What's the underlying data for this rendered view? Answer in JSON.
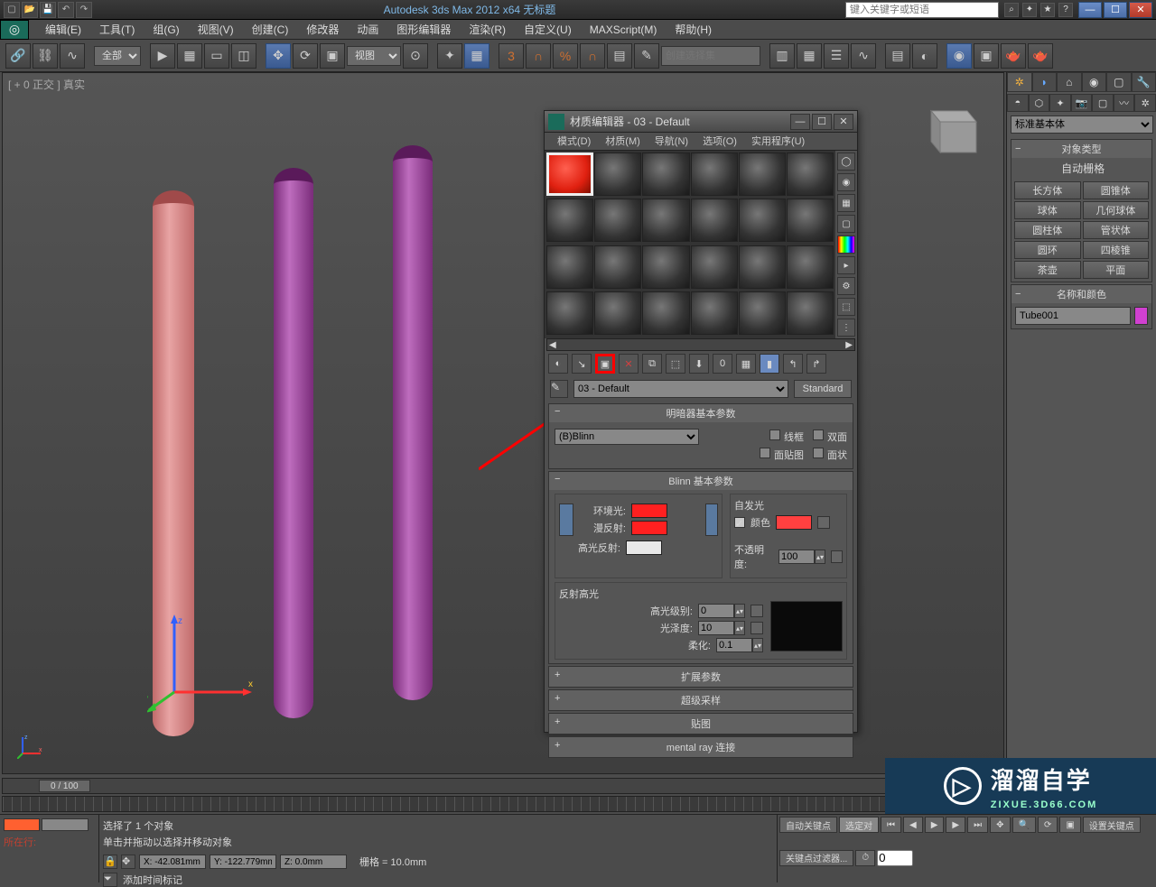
{
  "app": {
    "title": "Autodesk 3ds Max  2012 x64    无标题",
    "search_placeholder": "键入关键字或短语"
  },
  "menu": [
    "编辑(E)",
    "工具(T)",
    "组(G)",
    "视图(V)",
    "创建(C)",
    "修改器",
    "动画",
    "图形编辑器",
    "渲染(R)",
    "自定义(U)",
    "MAXScript(M)",
    "帮助(H)"
  ],
  "toolbar": {
    "filter": "全部",
    "viewset": "视图",
    "selset": "创建选择集"
  },
  "viewport": {
    "label": "[ + 0  正交 ] 真实"
  },
  "cmdpanel": {
    "dropdown": "标准基本体",
    "objtype_title": "对象类型",
    "autogrid": "自动栅格",
    "buttons": [
      [
        "长方体",
        "圆锥体"
      ],
      [
        "球体",
        "几何球体"
      ],
      [
        "圆柱体",
        "管状体"
      ],
      [
        "圆环",
        "四棱锥"
      ],
      [
        "茶壶",
        "平面"
      ]
    ],
    "namecolor_title": "名称和颜色",
    "objname": "Tube001"
  },
  "matedit": {
    "title": "材质编辑器 - 03 - Default",
    "menu": [
      "模式(D)",
      "材质(M)",
      "导航(N)",
      "选项(O)",
      "实用程序(U)"
    ],
    "matname": "03 - Default",
    "standard": "Standard",
    "shader_title": "明暗器基本参数",
    "shader": "(B)Blinn",
    "opt_wire": "线框",
    "opt_2side": "双面",
    "opt_facemap": "面贴图",
    "opt_faceted": "面状",
    "blinn_title": "Blinn 基本参数",
    "ambient": "环境光:",
    "diffuse": "漫反射:",
    "specular": "高光反射:",
    "selfillum_title": "自发光",
    "color_cb": "颜色",
    "opacity": "不透明度:",
    "opacity_val": "100",
    "spechl_title": "反射高光",
    "speclvl": "高光级别:",
    "speclvl_val": "0",
    "gloss": "光泽度:",
    "gloss_val": "10",
    "soften": "柔化:",
    "soften_val": "0.1",
    "rolls": [
      "扩展参数",
      "超级采样",
      "贴图",
      "mental ray 连接"
    ]
  },
  "time": {
    "slider": "0 / 100"
  },
  "status": {
    "script_label": "所在行:",
    "sel": "选择了 1 个对象",
    "hint": "单击并拖动以选择并移动对象",
    "x": "X: -42.081mm",
    "y": "Y: -122.779mm",
    "z": "Z: 0.0mm",
    "grid": "栅格 = 10.0mm",
    "addtime": "添加时间标记",
    "autokey": "自动关键点",
    "setkey": "设置关键点",
    "keyfilter": "关键点过滤器...",
    "selkey": "选定对"
  },
  "watermark": {
    "brand": "溜溜自学",
    "url": "ZIXUE.3D66.COM"
  }
}
